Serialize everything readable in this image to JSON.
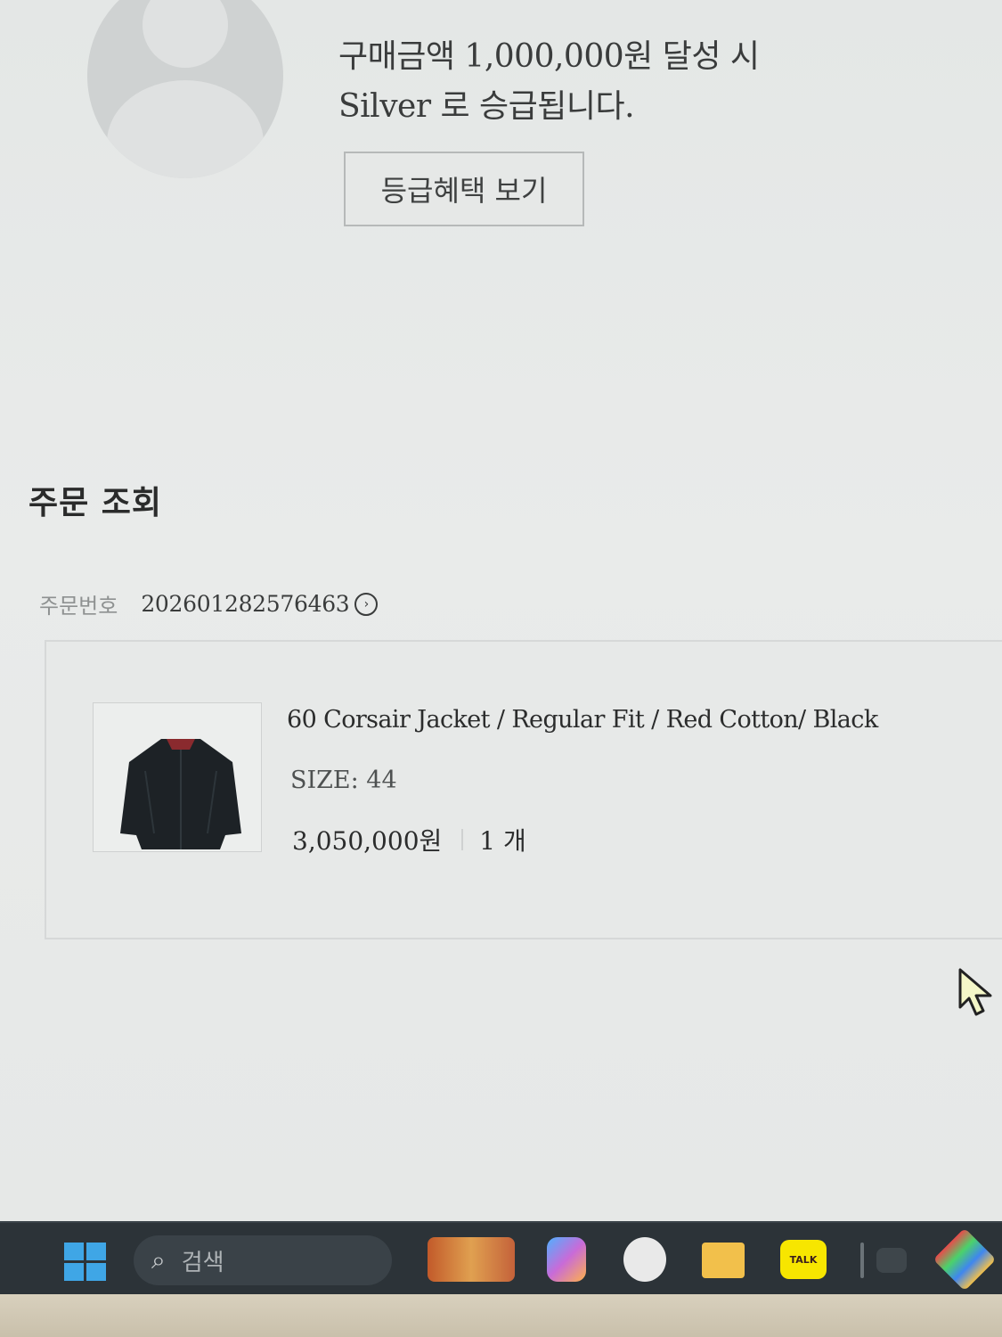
{
  "membership": {
    "message_line1": "구매금액 1,000,000원 달성 시",
    "message_line2": "Silver 로 승급됩니다.",
    "benefits_button": "등급혜택 보기"
  },
  "orders": {
    "section_title": "주문 조회",
    "order_number_label": "주문번호",
    "order_number": "202601282576463",
    "items": [
      {
        "name": "60 Corsair Jacket / Regular Fit / Red Cotton/ Black",
        "size": "SIZE: 44",
        "price": "3,050,000원",
        "quantity": "1 개"
      }
    ]
  },
  "taskbar": {
    "search_placeholder": "검색",
    "kakao_label": "TALK"
  },
  "icons": {
    "order_detail": "chevron-right-circle-icon",
    "search": "search-icon",
    "start": "windows-start-icon"
  },
  "colors": {
    "page_bg": "#e7e9e8",
    "taskbar_bg": "#2c3338",
    "windows_blue": "#3fa6e6",
    "kakao_yellow": "#f7e600"
  }
}
